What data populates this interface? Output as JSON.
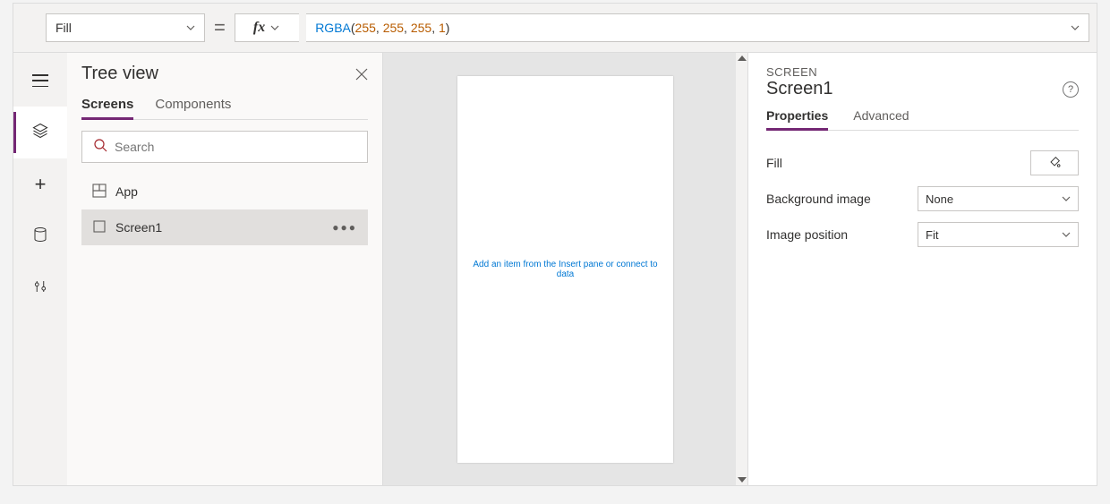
{
  "formula_bar": {
    "property": "Fill",
    "fx_label": "fx",
    "formula": {
      "fn": "RGBA",
      "args": [
        "255",
        "255",
        "255",
        "1"
      ]
    }
  },
  "tree_panel": {
    "title": "Tree view",
    "tabs": {
      "screens": "Screens",
      "components": "Components"
    },
    "search_placeholder": "Search",
    "items": [
      {
        "label": "App"
      },
      {
        "label": "Screen1"
      }
    ]
  },
  "canvas": {
    "hint": "Add an item from the Insert pane or connect to data"
  },
  "properties_panel": {
    "overline": "SCREEN",
    "title": "Screen1",
    "tabs": {
      "properties": "Properties",
      "advanced": "Advanced"
    },
    "rows": {
      "fill_label": "Fill",
      "bg_label": "Background image",
      "bg_value": "None",
      "imgpos_label": "Image position",
      "imgpos_value": "Fit"
    }
  }
}
